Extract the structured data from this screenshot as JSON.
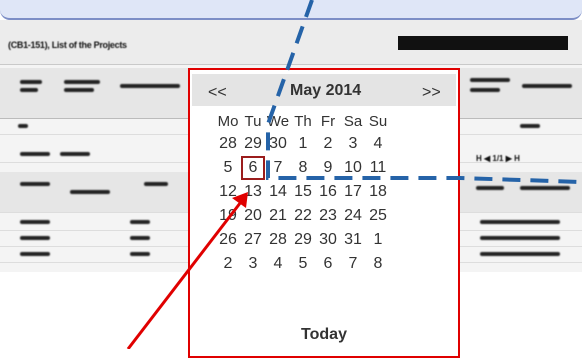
{
  "app": {
    "title": "(CB1-151), List of the Projects",
    "pager_label": "H ◀ 1/1 ▶ H"
  },
  "calendar": {
    "month_label": "May 2014",
    "prev_label": "<<",
    "next_label": ">>",
    "weekdays": [
      "Mo",
      "Tu",
      "We",
      "Th",
      "Fr",
      "Sa",
      "Su"
    ],
    "weeks": [
      [
        "28",
        "29",
        "30",
        "1",
        "2",
        "3",
        "4"
      ],
      [
        "5",
        "6",
        "7",
        "8",
        "9",
        "10",
        "11"
      ],
      [
        "12",
        "13",
        "14",
        "15",
        "16",
        "17",
        "18"
      ],
      [
        "19",
        "20",
        "21",
        "22",
        "23",
        "24",
        "25"
      ],
      [
        "26",
        "27",
        "28",
        "29",
        "30",
        "31",
        "1"
      ],
      [
        "2",
        "3",
        "4",
        "5",
        "6",
        "7",
        "8"
      ]
    ],
    "selected_day": "6",
    "today_label": "Today"
  },
  "colors": {
    "annotation_blue": "#2563a8",
    "annotation_red": "#e00000"
  }
}
